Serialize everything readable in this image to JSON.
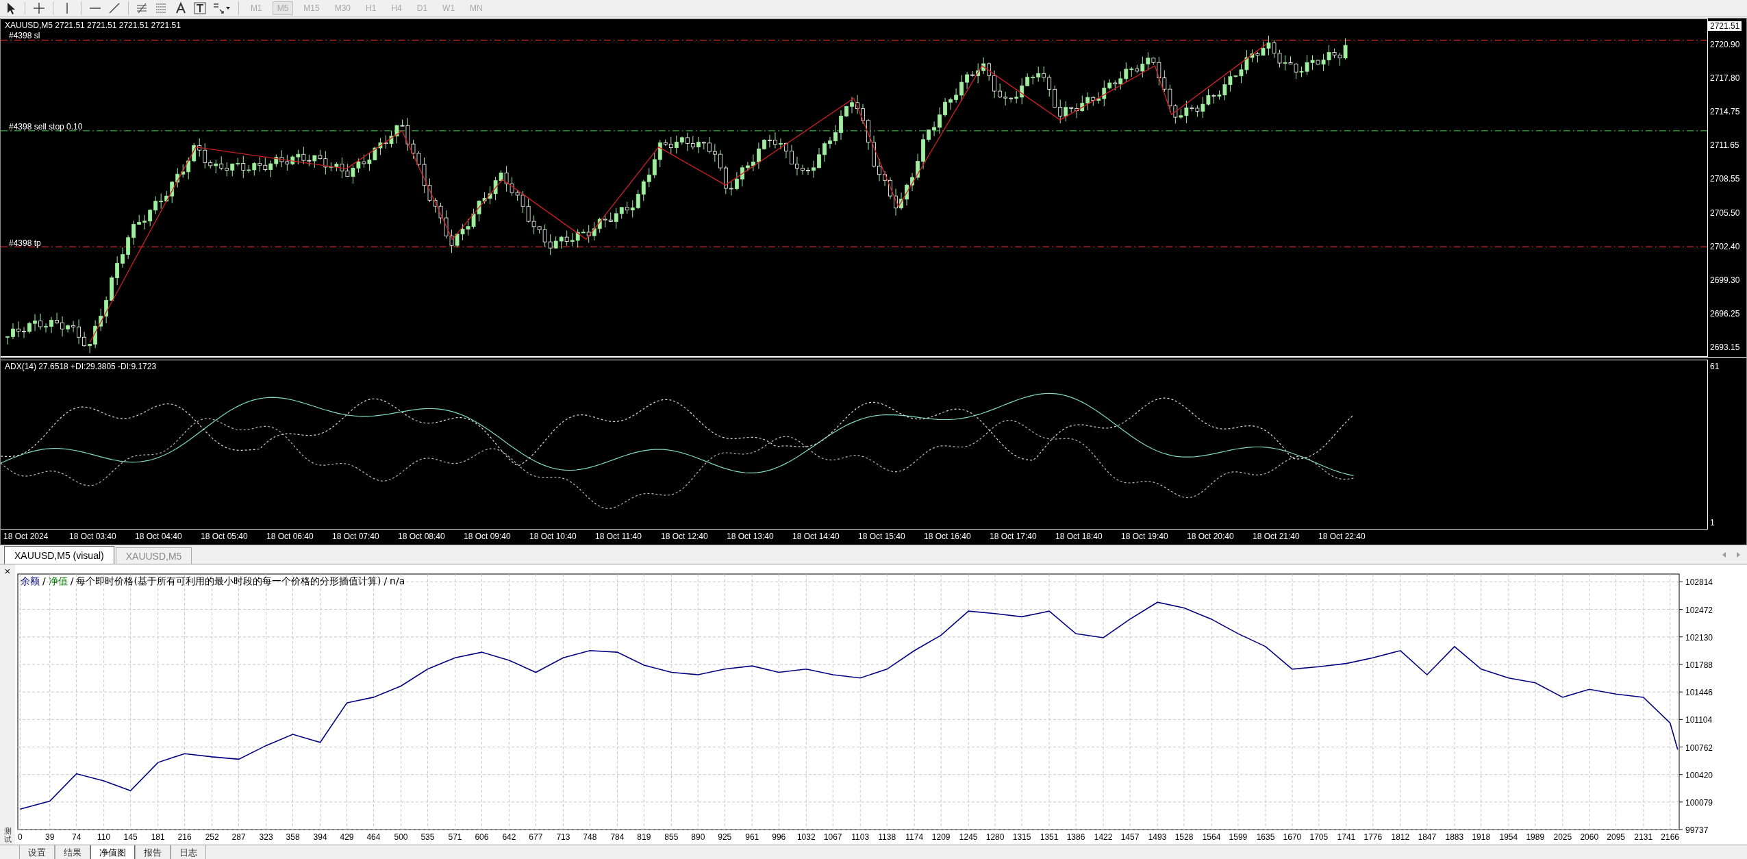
{
  "toolbar": {
    "timeframes": [
      {
        "label": "M1",
        "selected": false,
        "disabled": true
      },
      {
        "label": "M5",
        "selected": true,
        "disabled": true
      },
      {
        "label": "M15",
        "selected": false,
        "disabled": true
      },
      {
        "label": "M30",
        "selected": false,
        "disabled": true
      },
      {
        "label": "H1",
        "selected": false,
        "disabled": true
      },
      {
        "label": "H4",
        "selected": false,
        "disabled": true
      },
      {
        "label": "D1",
        "selected": false,
        "disabled": true
      },
      {
        "label": "W1",
        "selected": false,
        "disabled": true
      },
      {
        "label": "MN",
        "selected": false,
        "disabled": true
      }
    ]
  },
  "price_chart": {
    "title": "XAUUSD,M5  2721.51 2721.51 2721.51 2721.51",
    "current_price": "2721.51",
    "order_lines": [
      {
        "kind": "stop_loss",
        "label": "#4398 sl"
      },
      {
        "kind": "pending",
        "label": "#4398 sell stop 0.10"
      },
      {
        "kind": "take_profit",
        "label": "#4398 tp"
      }
    ],
    "price_axis": [
      "2720.90",
      "2717.80",
      "2714.75",
      "2711.65",
      "2708.55",
      "2705.50",
      "2702.40",
      "2699.30",
      "2696.25",
      "2693.15"
    ]
  },
  "indicator": {
    "label": "ADX(14) 27.6518 +DI:29.3805 -DI:9.1723",
    "axis": [
      "61",
      "1"
    ]
  },
  "time_axis": [
    "18 Oct 2024",
    "18 Oct 03:40",
    "18 Oct 04:40",
    "18 Oct 05:40",
    "18 Oct 06:40",
    "18 Oct 07:40",
    "18 Oct 08:40",
    "18 Oct 09:40",
    "18 Oct 10:40",
    "18 Oct 11:40",
    "18 Oct 12:40",
    "18 Oct 13:40",
    "18 Oct 14:40",
    "18 Oct 15:40",
    "18 Oct 16:40",
    "18 Oct 17:40",
    "18 Oct 18:40",
    "18 Oct 19:40",
    "18 Oct 20:40",
    "18 Oct 21:40",
    "18 Oct 22:40"
  ],
  "chart_tabs": [
    {
      "label": "XAUUSD,M5 (visual)",
      "selected": true
    },
    {
      "label": "XAUUSD,M5",
      "selected": false
    }
  ],
  "tester": {
    "close": "×",
    "side_label": "测试",
    "legend": [
      {
        "text": "/"
      },
      {
        "text": "净值",
        "color": "#008000"
      },
      {
        "text": "/"
      },
      {
        "text": "每个即时价格(基于所有可利用的最小时段的每一个价格的分形插值计算)"
      },
      {
        "text": "/"
      },
      {
        "text": "n/a"
      }
    ],
    "chart_data": {
      "type": "line",
      "x": [
        0,
        39,
        74,
        110,
        145,
        181,
        216,
        252,
        287,
        323,
        358,
        394,
        429,
        464,
        500,
        535,
        571,
        606,
        642,
        677,
        713,
        748,
        784,
        819,
        855,
        890,
        925,
        961,
        996,
        1032,
        1067,
        1103,
        1138,
        1174,
        1209,
        1245,
        1280,
        1315,
        1351,
        1386,
        1422,
        1457,
        1493,
        1528,
        1564,
        1599,
        1635,
        1670,
        1705,
        1741,
        1776,
        1812,
        1847,
        1883,
        1918,
        1954,
        1989,
        2025,
        2060,
        2095,
        2131,
        2166,
        2176
      ],
      "series": [
        {
          "name": "余额",
          "color": "#000080",
          "values": [
            99990,
            100090,
            100430,
            100340,
            100220,
            100570,
            100680,
            100640,
            100610,
            100780,
            100920,
            100820,
            101310,
            101380,
            101520,
            101730,
            101870,
            101940,
            101840,
            101690,
            101870,
            101960,
            101940,
            101780,
            101690,
            101660,
            101730,
            101770,
            101690,
            101730,
            101660,
            101620,
            101730,
            101960,
            102150,
            102450,
            102420,
            102380,
            102450,
            102170,
            102120,
            102350,
            102560,
            102490,
            102350,
            102170,
            102010,
            101730,
            101760,
            101800,
            101870,
            101960,
            101660,
            102010,
            101730,
            101620,
            101560,
            101380,
            101480,
            101420,
            101380,
            101060,
            100730
          ]
        }
      ],
      "grid": true,
      "xlim": [
        -3,
        2178
      ],
      "ylim": [
        99737,
        102911
      ],
      "xticks": [
        0,
        39,
        74,
        110,
        145,
        181,
        216,
        252,
        287,
        323,
        358,
        394,
        429,
        464,
        500,
        535,
        571,
        606,
        642,
        677,
        713,
        748,
        784,
        819,
        855,
        890,
        925,
        961,
        996,
        1032,
        1067,
        1103,
        1138,
        1174,
        1209,
        1245,
        1280,
        1315,
        1351,
        1386,
        1422,
        1457,
        1493,
        1528,
        1564,
        1599,
        1635,
        1670,
        1705,
        1741,
        1776,
        1812,
        1847,
        1883,
        1918,
        1954,
        1989,
        2025,
        2060,
        2095,
        2131,
        2166
      ],
      "yticks": [
        99737,
        100079,
        100420,
        100762,
        101104,
        101446,
        101788,
        102130,
        102472,
        102814
      ]
    }
  },
  "bottom_tabs": [
    {
      "label": "设置",
      "selected": false
    },
    {
      "label": "结果",
      "selected": false
    },
    {
      "label": "净值图",
      "selected": true
    },
    {
      "label": "报告",
      "selected": false
    },
    {
      "label": "日志",
      "selected": false
    }
  ]
}
